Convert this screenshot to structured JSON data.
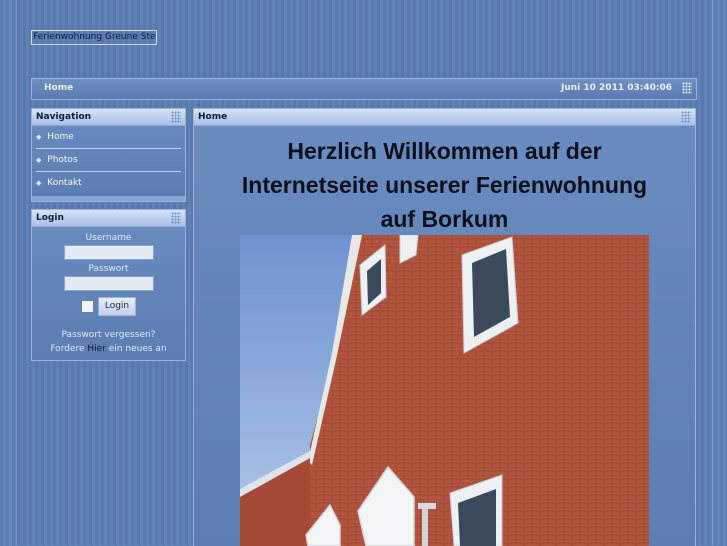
{
  "site": {
    "logo_text": "Ferienwohnung Greune Stee"
  },
  "topbar": {
    "breadcrumb": "Home",
    "datetime": "Juni 10 2011 03:40:06"
  },
  "navigation": {
    "title": "Navigation",
    "items": [
      {
        "label": "Home"
      },
      {
        "label": "Photos"
      },
      {
        "label": "Kontakt"
      }
    ]
  },
  "login": {
    "title": "Login",
    "username_label": "Username",
    "password_label": "Passwort",
    "submit_label": "Login",
    "forgot_text": "Passwort vergessen?",
    "new_prefix": "Fordere",
    "new_link": "Hier",
    "new_suffix": "ein neues an"
  },
  "main": {
    "title": "Home",
    "headline_lines": [
      "Herzlich Willkommen auf der",
      "Internetseite unserer Ferienwohnung",
      "auf Borkum"
    ]
  }
}
